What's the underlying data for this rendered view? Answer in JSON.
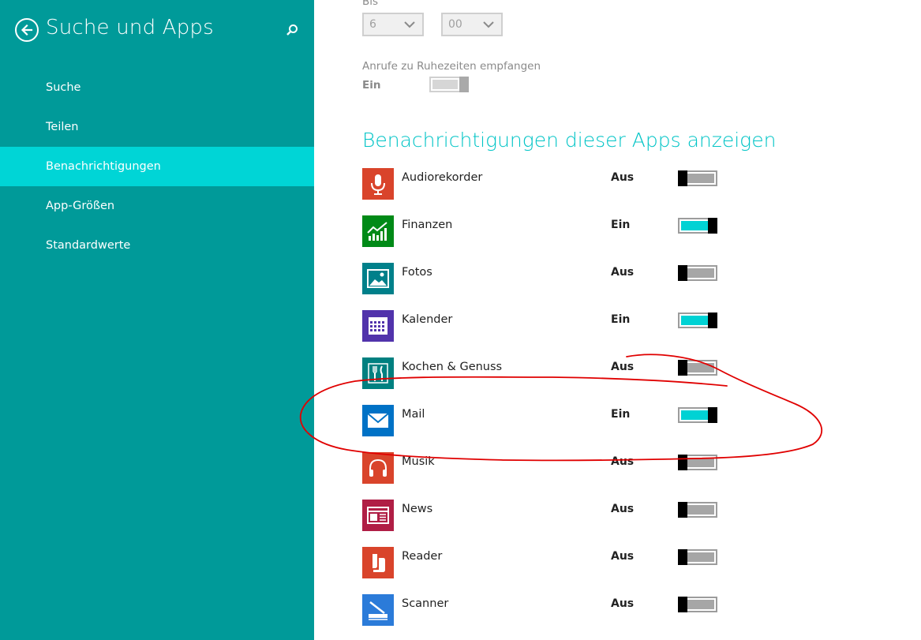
{
  "sidebar": {
    "title": "Suche und Apps",
    "items": [
      {
        "label": "Suche",
        "selected": false
      },
      {
        "label": "Teilen",
        "selected": false
      },
      {
        "label": "Benachrichtigungen",
        "selected": true
      },
      {
        "label": "App-Größen",
        "selected": false
      },
      {
        "label": "Standardwerte",
        "selected": false
      }
    ]
  },
  "quiet_hours": {
    "until_label": "Bis",
    "hour_value": "6",
    "minute_value": "00",
    "calls_label": "Anrufe zu Ruhezeiten empfangen",
    "calls_state": "Ein"
  },
  "notifications": {
    "heading": "Benachrichtigungen dieser Apps anzeigen",
    "apps": [
      {
        "name": "Audiorekorder",
        "state": "Aus",
        "on": false,
        "icon": "microphone-icon",
        "color": "#d9442b"
      },
      {
        "name": "Finanzen",
        "state": "Ein",
        "on": true,
        "icon": "finance-chart-icon",
        "color": "#008a17"
      },
      {
        "name": "Fotos",
        "state": "Aus",
        "on": false,
        "icon": "photo-icon",
        "color": "#00808a"
      },
      {
        "name": "Kalender",
        "state": "Ein",
        "on": true,
        "icon": "calendar-icon",
        "color": "#5133ab"
      },
      {
        "name": "Kochen & Genuss",
        "state": "Aus",
        "on": false,
        "icon": "fork-knife-icon",
        "color": "#008080"
      },
      {
        "name": "Mail",
        "state": "Ein",
        "on": true,
        "icon": "mail-icon",
        "color": "#0072c6"
      },
      {
        "name": "Musik",
        "state": "Aus",
        "on": false,
        "icon": "headphones-icon",
        "color": "#d9442b"
      },
      {
        "name": "News",
        "state": "Aus",
        "on": false,
        "icon": "newspaper-icon",
        "color": "#b01e45"
      },
      {
        "name": "Reader",
        "state": "Aus",
        "on": false,
        "icon": "reader-icon",
        "color": "#d9442b"
      },
      {
        "name": "Scanner",
        "state": "Aus",
        "on": false,
        "icon": "scanner-icon",
        "color": "#2b7bd9"
      }
    ]
  },
  "colors": {
    "sidebar_bg": "#009a99",
    "sidebar_selected": "#00d5d6",
    "accent": "#00c4c6",
    "annotation": "#e00000"
  }
}
